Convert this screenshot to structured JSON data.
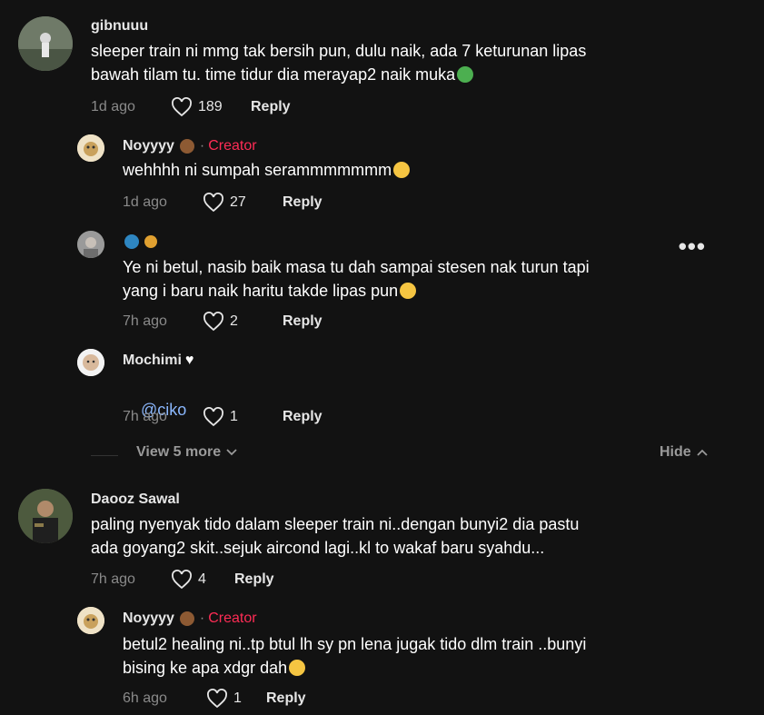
{
  "comments": [
    {
      "username": "gibnuuu",
      "text": "sleeper train ni mmg tak bersih pun, dulu naik, ada 7 keturunan lipas\nbawah tilam tu. time tidur dia merayap2 naik muka",
      "emoji": "nauseated-face",
      "time": "1d ago",
      "likes": "189",
      "reply_label": "Reply"
    },
    {
      "username": "Noyyyy",
      "username_emoji": "bear-face",
      "creator_label": "Creator",
      "text": "wehhhh ni sumpah serammmmmmm",
      "emoji": "flushed-face",
      "time": "1d ago",
      "likes": "27",
      "reply_label": "Reply"
    },
    {
      "username_emoji": "globe-and-planet",
      "text": "Ye ni betul, nasib baik masa tu dah sampai stesen nak turun tapi\nyang i baru naik haritu takde lipas pun",
      "emoji": "laughing-face",
      "time": "7h ago",
      "likes": "2",
      "reply_label": "Reply"
    },
    {
      "username": "Mochimi",
      "username_emoji": "white-heart",
      "text": "@ciko",
      "time": "7h ago",
      "likes": "1",
      "reply_label": "Reply"
    },
    {
      "username": "Daooz Sawal",
      "text": "paling nyenyak tido dalam sleeper train ni..dengan bunyi2 dia pastu\nada goyang2 skit..sejuk aircond lagi..kl to wakaf baru syahdu...",
      "time": "7h ago",
      "likes": "4",
      "reply_label": "Reply"
    },
    {
      "username": "Noyyyy",
      "username_emoji": "bear-face",
      "creator_label": "Creator",
      "text": "betul2 healing ni..tp btul lh sy pn lena jugak tido dlm train ..bunyi\nbising ke apa xdgr dah",
      "emoji": "sweat-smile-face",
      "time": "6h ago",
      "likes": "1",
      "reply_label": "Reply"
    }
  ],
  "thread": {
    "view_more_label": "View 5 more",
    "hide_label": "Hide"
  },
  "colors": {
    "background": "#121212",
    "creator": "#fe2c55",
    "mention": "#8bb8ff",
    "muted": "#8a8a8a"
  }
}
